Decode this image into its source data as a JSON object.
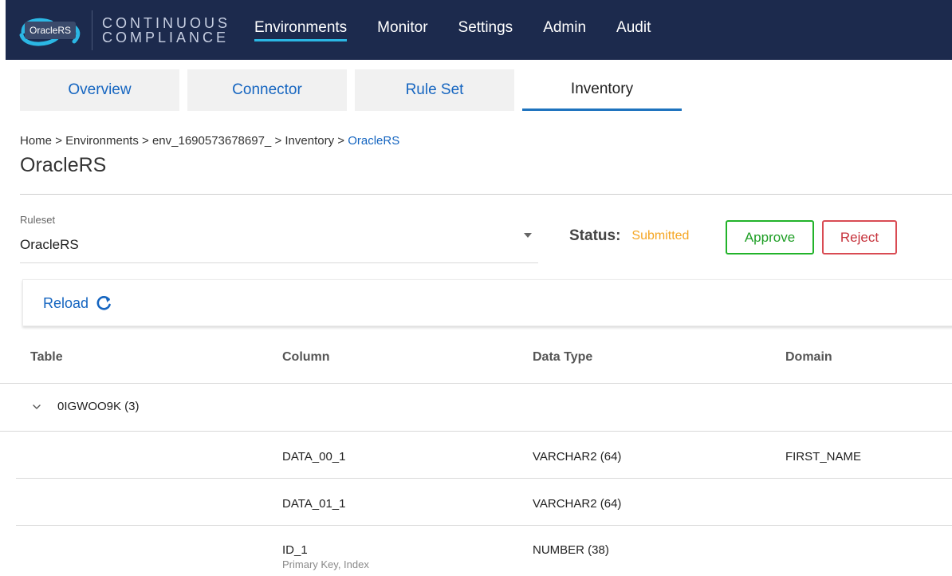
{
  "app": {
    "badge": "OracleRS",
    "brand_line1": "CONTINUOUS",
    "brand_line2": "COMPLIANCE"
  },
  "nav": {
    "items": [
      {
        "label": "Environments",
        "active": true
      },
      {
        "label": "Monitor"
      },
      {
        "label": "Settings"
      },
      {
        "label": "Admin"
      },
      {
        "label": "Audit"
      }
    ]
  },
  "tabs": [
    {
      "label": "Overview"
    },
    {
      "label": "Connector"
    },
    {
      "label": "Rule Set"
    },
    {
      "label": "Inventory",
      "active": true
    }
  ],
  "breadcrumb": {
    "items": [
      "Home",
      "Environments",
      "env_1690573678697_",
      "Inventory"
    ],
    "current": "OracleRS",
    "separator": ">"
  },
  "page": {
    "title": "OracleRS"
  },
  "ruleset": {
    "label": "Ruleset",
    "value": "OracleRS"
  },
  "status": {
    "label": "Status:",
    "value": "Submitted"
  },
  "actions": {
    "approve": "Approve",
    "reject": "Reject",
    "reload": "Reload"
  },
  "table": {
    "headers": {
      "table": "Table",
      "column": "Column",
      "data_type": "Data Type",
      "domain": "Domain"
    },
    "group": {
      "label": "0IGWOO9K (3)"
    },
    "rows": [
      {
        "column": "DATA_00_1",
        "data_type": "VARCHAR2 (64)",
        "domain": "FIRST_NAME"
      },
      {
        "column": "DATA_01_1",
        "data_type": "VARCHAR2 (64)",
        "domain": ""
      },
      {
        "column": "ID_1",
        "data_type": "NUMBER (38)",
        "domain": "",
        "note": "Primary Key, Index"
      }
    ]
  },
  "colors": {
    "nav_bg": "#1c2a4d",
    "nav_active_underline": "#2bb7e4",
    "link": "#1565c0",
    "status_submitted": "#f5a623",
    "approve": "#22b32a",
    "reject": "#d94b53"
  }
}
